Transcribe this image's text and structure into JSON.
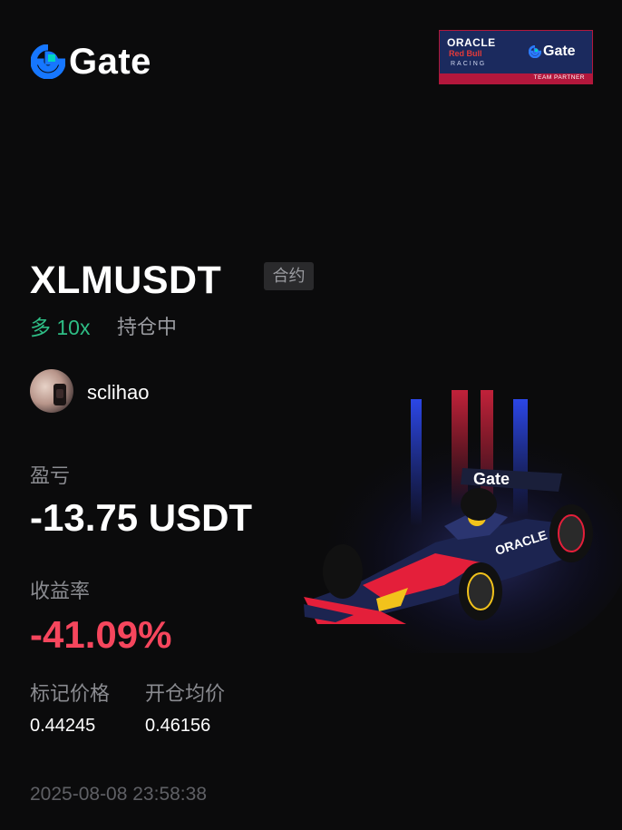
{
  "brand": {
    "name": "Gate",
    "logo_icon": "gate-logo-icon",
    "accent": "#1677ff",
    "accent2": "#00d5c0"
  },
  "partner_badge": {
    "line1": "ORACLE",
    "line2": "Red Bull",
    "line3": "RACING",
    "partner_brand": "Gate",
    "footer": "TEAM PARTNER"
  },
  "position": {
    "symbol": "XLMUSDT",
    "type_tag": "合约",
    "side": "多 10x",
    "status": "持仓中",
    "side_color": "#2ebd85"
  },
  "user": {
    "username": "sclihao",
    "avatar_icon": "avatar-icon"
  },
  "pnl": {
    "label": "盈亏",
    "value": "-13.75 USDT"
  },
  "roi": {
    "label": "收益率",
    "value": "-41.09%",
    "color": "#f6465d"
  },
  "prices": {
    "mark_label": "标记价格",
    "mark_value": "0.44245",
    "entry_label": "开仓均价",
    "entry_value": "0.46156"
  },
  "timestamp": "2025-08-08 23:58:38",
  "car_image": {
    "icon": "f1-car-icon",
    "livery_text": "Gate"
  }
}
